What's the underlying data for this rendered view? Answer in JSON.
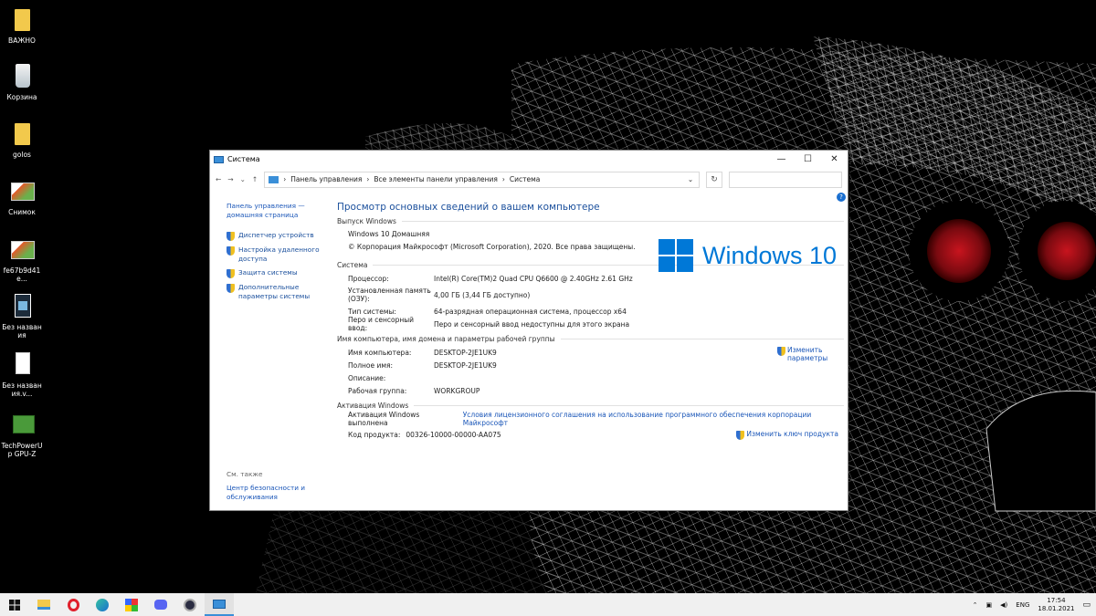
{
  "desktop": {
    "icons": [
      {
        "label": "ВАЖНО"
      },
      {
        "label": "Корзина"
      },
      {
        "label": "golos"
      },
      {
        "label": "Снимок"
      },
      {
        "label": "fe67b9d41e..."
      },
      {
        "label": "Без названия"
      },
      {
        "label": "Без названия.v..."
      },
      {
        "label": "TechPowerUp GPU-Z"
      }
    ]
  },
  "window": {
    "title": "Система",
    "controls": {
      "minimize": "—",
      "maximize": "☐",
      "close": "✕"
    },
    "breadcrumb": [
      "Панель управления",
      "Все элементы панели управления",
      "Система"
    ],
    "sidebar": {
      "home": "Панель управления — домашняя страница",
      "items": [
        "Диспетчер устройств",
        "Настройка удаленного доступа",
        "Защита системы",
        "Дополнительные параметры системы"
      ],
      "see_also_title": "См. также",
      "see_also": "Центр безопасности и обслуживания"
    },
    "main": {
      "heading": "Просмотр основных сведений о вашем компьютере",
      "edition_section": "Выпуск Windows",
      "edition": "Windows 10 Домашняя",
      "copyright": "© Корпорация Майкрософт (Microsoft Corporation), 2020. Все права защищены.",
      "logo_text": "Windows 10",
      "system_section": "Система",
      "system_rows": [
        {
          "k": "Процессор:",
          "v": "Intel(R) Core(TM)2 Quad CPU    Q6600  @ 2.40GHz   2.61 GHz"
        },
        {
          "k": "Установленная память (ОЗУ):",
          "v": "4,00 ГБ (3,44 ГБ доступно)"
        },
        {
          "k": "Тип системы:",
          "v": "64-разрядная операционная система, процессор x64"
        },
        {
          "k": "Перо и сенсорный ввод:",
          "v": "Перо и сенсорный ввод недоступны для этого экрана"
        }
      ],
      "computer_section": "Имя компьютера, имя домена и параметры рабочей группы",
      "computer_rows": [
        {
          "k": "Имя компьютера:",
          "v": "DESKTOP-2JE1UK9"
        },
        {
          "k": "Полное имя:",
          "v": "DESKTOP-2JE1UK9"
        },
        {
          "k": "Описание:",
          "v": ""
        },
        {
          "k": "Рабочая группа:",
          "v": "WORKGROUP"
        }
      ],
      "change_params": "Изменить параметры",
      "activation_section": "Активация Windows",
      "activation_status": "Активация Windows выполнена",
      "license_link": "Условия лицензионного соглашения на использование программного обеспечения корпорации Майкрософт",
      "product_key_label": "Код продукта:",
      "product_key": "00326-10000-00000-AA075",
      "change_key": "Изменить ключ продукта"
    }
  },
  "taskbar": {
    "lang": "ENG",
    "time": "17:54",
    "date": "18.01.2021",
    "apps": [
      "file-explorer",
      "opera",
      "edge",
      "rubiks-cube",
      "discord",
      "obs",
      "system-window"
    ]
  },
  "colors": {
    "link": "#1a56b8",
    "heading": "#1a4f9c",
    "windows_blue": "#0078d7"
  }
}
